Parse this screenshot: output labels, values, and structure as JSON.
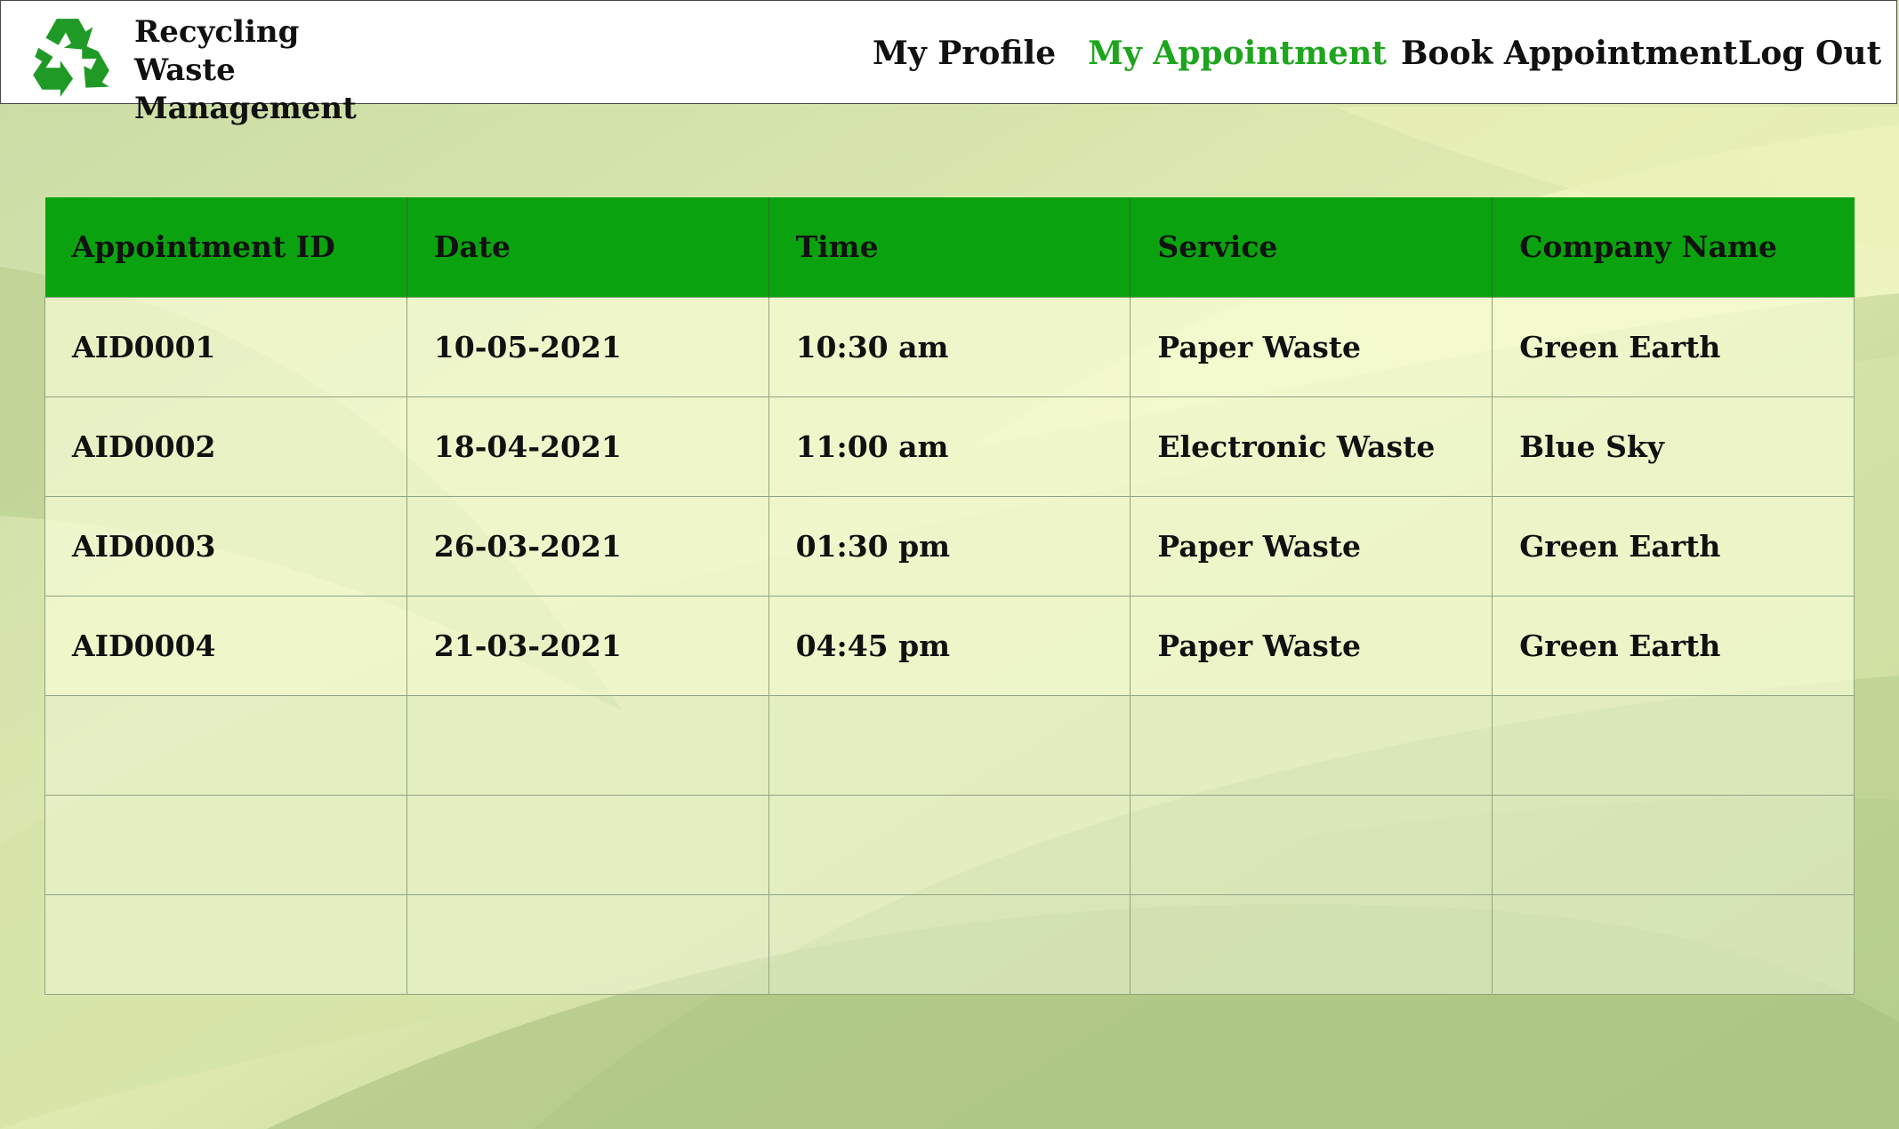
{
  "app": {
    "title_line1": "Recycling Waste",
    "title_line2": "Management",
    "logo_icon": "recycle-icon",
    "accent_color": "#0aa30f",
    "active_nav_color": "#1ea51e"
  },
  "nav": {
    "my_profile": "My Profile",
    "my_appointment": "My Appointment",
    "book_appointment": "Book Appointment",
    "log_out": "Log Out",
    "active": "My Appointment"
  },
  "table": {
    "headers": [
      "Appointment ID",
      "Date",
      "Time",
      "Service",
      "Company Name"
    ],
    "rows": [
      [
        "AID0001",
        "10-05-2021",
        "10:30 am",
        "Paper Waste",
        "Green Earth"
      ],
      [
        "AID0002",
        "18-04-2021",
        "11:00 am",
        "Electronic Waste",
        "Blue Sky"
      ],
      [
        "AID0003",
        "26-03-2021",
        "01:30 pm",
        "Paper Waste",
        "Green Earth"
      ],
      [
        "AID0004",
        "21-03-2021",
        "04:45 pm",
        "Paper Waste",
        "Green Earth"
      ],
      [
        "",
        "",
        "",
        "",
        ""
      ],
      [
        "",
        "",
        "",
        "",
        ""
      ],
      [
        "",
        "",
        "",
        "",
        ""
      ]
    ]
  }
}
